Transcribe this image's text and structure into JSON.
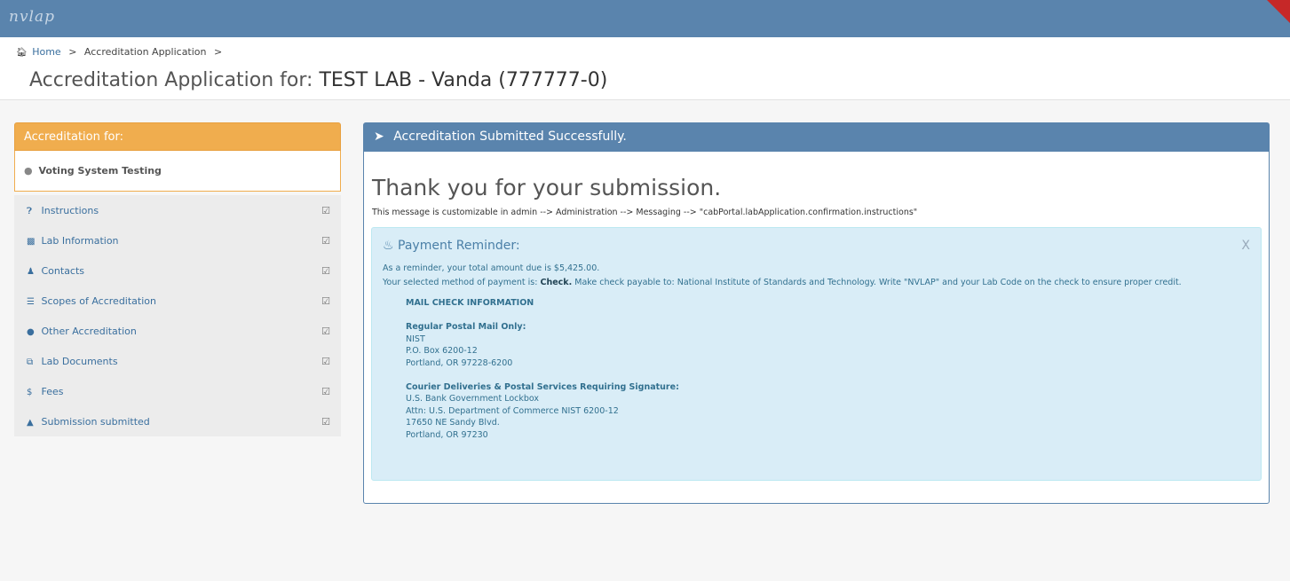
{
  "header": {
    "brand": "nvlap"
  },
  "breadcrumb": {
    "home": "Home",
    "sep1": ">",
    "current": "Accreditation Application",
    "sep2": ">"
  },
  "page": {
    "title_prefix": "Accreditation Application for:",
    "lab_name": "TEST LAB - Vanda (777777-0)"
  },
  "sidebar": {
    "heading": "Accreditation for:",
    "current_program": "Voting System Testing",
    "items": [
      {
        "label": "Instructions",
        "icon": "info-circle-icon"
      },
      {
        "label": "Lab Information",
        "icon": "building-icon"
      },
      {
        "label": "Contacts",
        "icon": "user-icon"
      },
      {
        "label": "Scopes of Accreditation",
        "icon": "list-icon"
      },
      {
        "label": "Other Accreditation",
        "icon": "circle-icon"
      },
      {
        "label": "Lab Documents",
        "icon": "copy-icon"
      },
      {
        "label": "Fees",
        "icon": "dollar-icon"
      },
      {
        "label": "Submission submitted",
        "icon": "thumbs-up-icon"
      }
    ]
  },
  "panel": {
    "heading": "Accreditation Submitted Successfully.",
    "thanks": "Thank you for your submission.",
    "custom_message": "This message is customizable in admin --> Administration --> Messaging --> \"cabPortal.labApplication.confirmation.instructions\""
  },
  "reminder": {
    "title": "Payment Reminder:",
    "close": "X",
    "amount_line": "As a reminder, your total amount due is $5,425.00.",
    "method_prefix": "Your selected method of payment is:",
    "method": "Check.",
    "method_suffix": "Make check payable to: National Institute of Standards and Technology. Write \"NVLAP\" and your Lab Code on the check to ensure proper credit.",
    "mail_heading": "MAIL CHECK INFORMATION",
    "regular_heading": "Regular Postal Mail Only:",
    "regular_lines": [
      "NIST",
      "P.O. Box 6200-12",
      "Portland, OR 97228-6200"
    ],
    "courier_heading": "Courier Deliveries & Postal Services Requiring Signature:",
    "courier_lines": [
      "U.S. Bank Government Lockbox",
      "Attn: U.S. Department of Commerce NIST 6200-12",
      "17650 NE Sandy Blvd.",
      "Portland, OR 97230"
    ]
  }
}
